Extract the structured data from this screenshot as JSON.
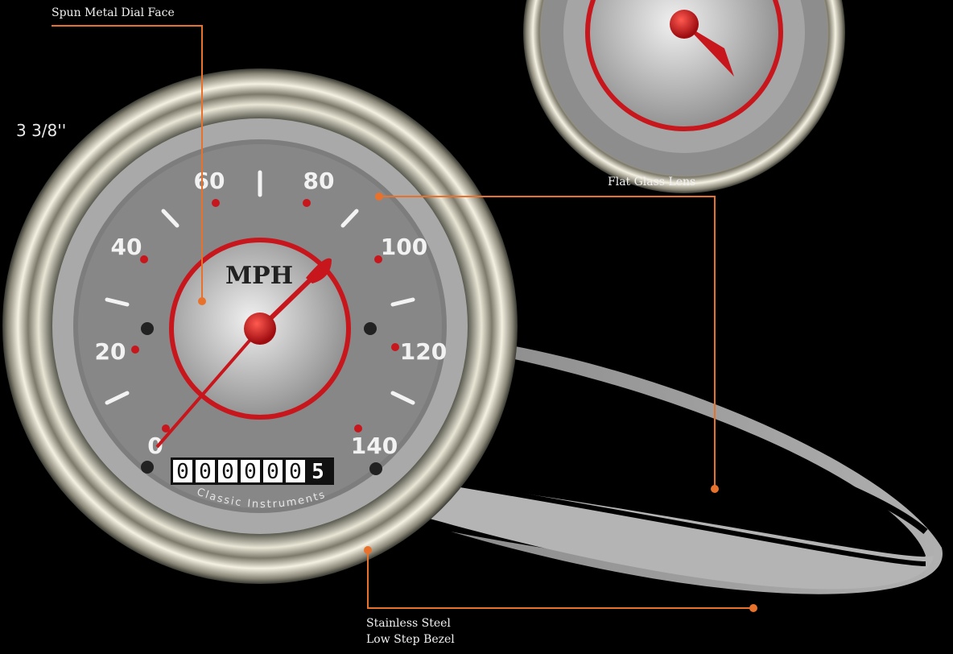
{
  "product": {
    "size_label": "3 3/8''",
    "dial_unit": "MPH",
    "brand": "Classic Instruments",
    "odometer_digits": [
      "0",
      "0",
      "0",
      "0",
      "0",
      "0",
      "5"
    ]
  },
  "speed_scale": [
    "0",
    "20",
    "40",
    "60",
    "80",
    "100",
    "120",
    "140"
  ],
  "callouts": {
    "dial_face": "Spun Metal Dial Face",
    "lens": "Flat Glass Lens",
    "bezel_line1": "Stainless Steel",
    "bezel_line2": "Low Step Bezel"
  },
  "colors": {
    "background": "#000000",
    "accent_red": "#c8161d",
    "callout_orange": "#e8722c",
    "dial_gray": "#8c8c8c"
  }
}
